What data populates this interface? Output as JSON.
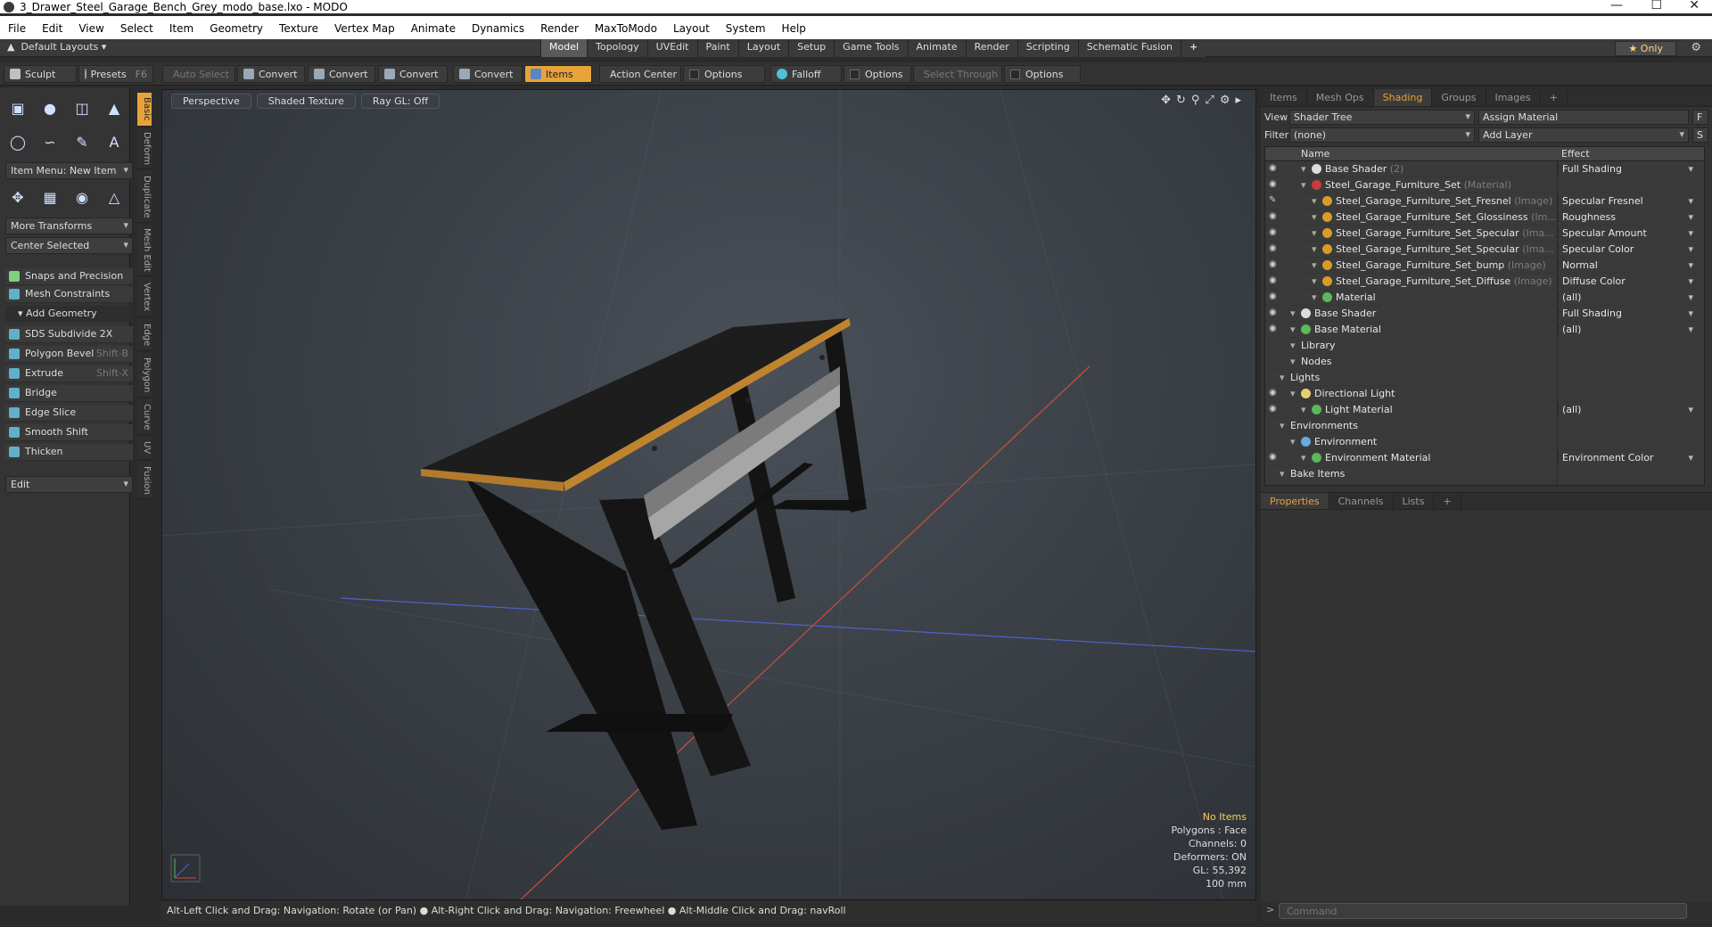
{
  "window": {
    "title": "3_Drawer_Steel_Garage_Bench_Grey_modo_base.lxo - MODO"
  },
  "menu": [
    "File",
    "Edit",
    "View",
    "Select",
    "Item",
    "Geometry",
    "Texture",
    "Vertex Map",
    "Animate",
    "Dynamics",
    "Render",
    "MaxToModo",
    "Layout",
    "System",
    "Help"
  ],
  "layout_bar": {
    "layout_label": "Default Layouts",
    "tabs": [
      "Model",
      "Topology",
      "UVEdit",
      "Paint",
      "Layout",
      "Setup",
      "Game Tools",
      "Animate",
      "Render",
      "Scripting",
      "Schematic Fusion"
    ],
    "active_tab": "Model",
    "add_label": "+",
    "only_label": "Only"
  },
  "toolbar": {
    "sculpt": "Sculpt",
    "presets": "Presets",
    "presets_key": "F6",
    "auto_select": "Auto Select",
    "convert1": "Convert",
    "convert2": "Convert",
    "convert3": "Convert",
    "convert4": "Convert",
    "items": "Items",
    "action_center": "Action Center",
    "options1": "Options",
    "falloff": "Falloff",
    "options2": "Options",
    "select_through": "Select Through",
    "options3": "Options"
  },
  "left_panel": {
    "item_menu": "Item Menu: New Item",
    "more_transforms": "More Transforms",
    "center_selected": "Center Selected",
    "snaps": "Snaps and Precision",
    "mesh_constraints": "Mesh Constraints",
    "add_geometry": "Add Geometry",
    "tools": [
      {
        "label": "SDS Subdivide 2X",
        "shortcut": ""
      },
      {
        "label": "Polygon Bevel",
        "shortcut": "Shift-B"
      },
      {
        "label": "Extrude",
        "shortcut": "Shift-X"
      },
      {
        "label": "Bridge",
        "shortcut": ""
      },
      {
        "label": "Edge Slice",
        "shortcut": ""
      },
      {
        "label": "Smooth Shift",
        "shortcut": ""
      },
      {
        "label": "Thicken",
        "shortcut": ""
      }
    ],
    "edit": "Edit",
    "vertical_tabs": [
      "Basic",
      "Deform",
      "Duplicate",
      "Mesh Edit",
      "Vertex",
      "Edge",
      "Polygon",
      "Curve",
      "UV",
      "Fusion"
    ]
  },
  "viewport": {
    "view": "Perspective",
    "shading": "Shaded Texture",
    "raygl": "Ray GL: Off",
    "info": {
      "no_items": "No Items",
      "polygons": "Polygons : Face",
      "channels": "Channels: 0",
      "deformers": "Deformers: ON",
      "gl": "GL: 55,392",
      "scale": "100 mm"
    }
  },
  "status_bar": "Alt-Left Click and Drag: Navigation: Rotate (or Pan) ●  Alt-Right Click and Drag: Navigation: Freewheel ●  Alt-Middle Click and Drag: navRoll",
  "right_panel": {
    "tabs": [
      "Items",
      "Mesh Ops",
      "Shading",
      "Groups",
      "Images",
      "+"
    ],
    "active_tab": "Shading",
    "view_label": "View",
    "view_value": "Shader Tree",
    "assign_material": "Assign Material",
    "assign_key": "F",
    "filter_label": "Filter",
    "filter_value": "(none)",
    "add_layer": "Add Layer",
    "add_layer_key": "S",
    "tree_headers": {
      "name": "Name",
      "effect": "Effect"
    },
    "tree": [
      {
        "indent": 2,
        "name": "Base Shader",
        "sub": "(2)",
        "effect": "Full Shading",
        "color": "#dcdcdc",
        "eye": true
      },
      {
        "indent": 2,
        "name": "Steel_Garage_Furniture_Set",
        "sub": "(Material)",
        "effect": "",
        "color": "#c83c3c",
        "eye": true
      },
      {
        "indent": 3,
        "name": "Steel_Garage_Furniture_Set_Fresnel",
        "sub": "(Image)",
        "effect": "Specular Fresnel",
        "color": "#d89a2a",
        "eye": true,
        "brush": true
      },
      {
        "indent": 3,
        "name": "Steel_Garage_Furniture_Set_Glossiness",
        "sub": "(Im...",
        "effect": "Roughness",
        "color": "#d89a2a",
        "eye": true
      },
      {
        "indent": 3,
        "name": "Steel_Garage_Furniture_Set_Specular",
        "sub": "(Ima...",
        "effect": "Specular Amount",
        "color": "#d89a2a",
        "eye": true
      },
      {
        "indent": 3,
        "name": "Steel_Garage_Furniture_Set_Specular",
        "sub": "(Ima...",
        "effect": "Specular Color",
        "color": "#d89a2a",
        "eye": true
      },
      {
        "indent": 3,
        "name": "Steel_Garage_Furniture_Set_bump",
        "sub": "(Image)",
        "effect": "Normal",
        "color": "#d89a2a",
        "eye": true
      },
      {
        "indent": 3,
        "name": "Steel_Garage_Furniture_Set_Diffuse",
        "sub": "(Image)",
        "effect": "Diffuse Color",
        "color": "#d89a2a",
        "eye": true
      },
      {
        "indent": 3,
        "name": "Material",
        "sub": "",
        "effect": "(all)",
        "color": "#5cb85c",
        "eye": true
      },
      {
        "indent": 1,
        "name": "Base Shader",
        "sub": "",
        "effect": "Full Shading",
        "color": "#dcdcdc",
        "eye": true
      },
      {
        "indent": 1,
        "name": "Base Material",
        "sub": "",
        "effect": "(all)",
        "color": "#5cb85c",
        "eye": true
      },
      {
        "indent": 1,
        "name": "Library",
        "sub": "",
        "effect": "",
        "color": "",
        "eye": false
      },
      {
        "indent": 1,
        "name": "Nodes",
        "sub": "",
        "effect": "",
        "color": "",
        "eye": false
      },
      {
        "indent": 0,
        "name": "Lights",
        "sub": "",
        "effect": "",
        "color": "",
        "eye": false
      },
      {
        "indent": 1,
        "name": "Directional Light",
        "sub": "",
        "effect": "",
        "color": "#e8d070",
        "eye": true
      },
      {
        "indent": 2,
        "name": "Light Material",
        "sub": "",
        "effect": "(all)",
        "color": "#5cb85c",
        "eye": true
      },
      {
        "indent": 0,
        "name": "Environments",
        "sub": "",
        "effect": "",
        "color": "",
        "eye": false
      },
      {
        "indent": 1,
        "name": "Environment",
        "sub": "",
        "effect": "",
        "color": "#6aa8e0",
        "eye": false
      },
      {
        "indent": 2,
        "name": "Environment Material",
        "sub": "",
        "effect": "Environment Color",
        "color": "#5cb85c",
        "eye": true
      },
      {
        "indent": 0,
        "name": "Bake Items",
        "sub": "",
        "effect": "",
        "color": "",
        "eye": false
      }
    ],
    "props_tabs": [
      "Properties",
      "Channels",
      "Lists",
      "+"
    ],
    "props_active": "Properties",
    "command_placeholder": "Command"
  }
}
